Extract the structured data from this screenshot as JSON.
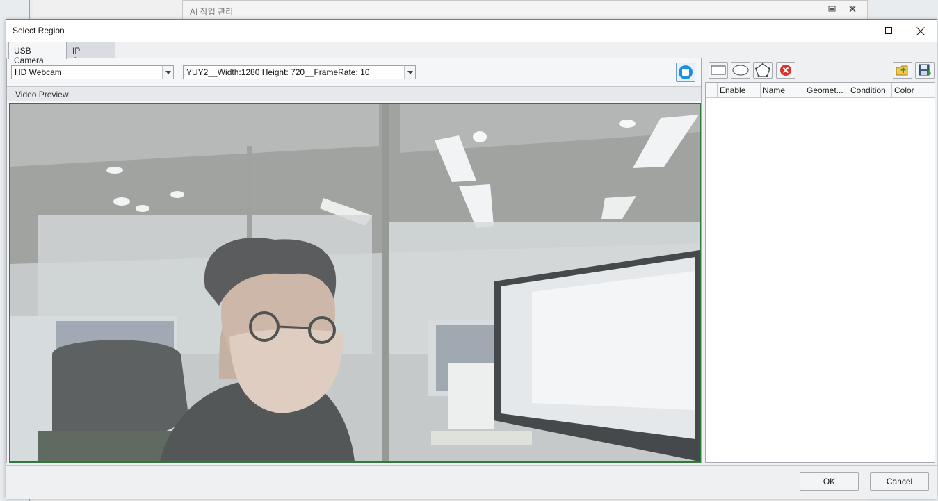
{
  "background_window": {
    "title": "AI 작업 관리"
  },
  "dialog": {
    "title": "Select Region",
    "tabs": [
      {
        "label": "USB Camera",
        "active": true
      },
      {
        "label": "IP Camera",
        "active": false
      }
    ],
    "device_combo": {
      "value": "HD Webcam"
    },
    "format_combo": {
      "value": "YUY2__Width:1280 Height: 720__FrameRate: 10"
    },
    "stop_button": {
      "icon": "stop-icon",
      "color": "#1e8fe0"
    },
    "preview": {
      "header": "Video Preview",
      "border_color": "#2f7a38"
    },
    "toolbar": {
      "left_tools": [
        {
          "icon": "rectangle-icon"
        },
        {
          "icon": "ellipse-icon"
        },
        {
          "icon": "polygon-icon"
        },
        {
          "icon": "delete-icon",
          "color": "#d9312b"
        }
      ],
      "right_tools": [
        {
          "icon": "open-folder-icon"
        },
        {
          "icon": "save-icon"
        }
      ]
    },
    "grid": {
      "columns": [
        "",
        "Enable",
        "Name",
        "Geomet...",
        "Condition",
        "Color"
      ],
      "rows": []
    },
    "buttons": {
      "ok_label": "OK",
      "cancel_label": "Cancel"
    }
  }
}
